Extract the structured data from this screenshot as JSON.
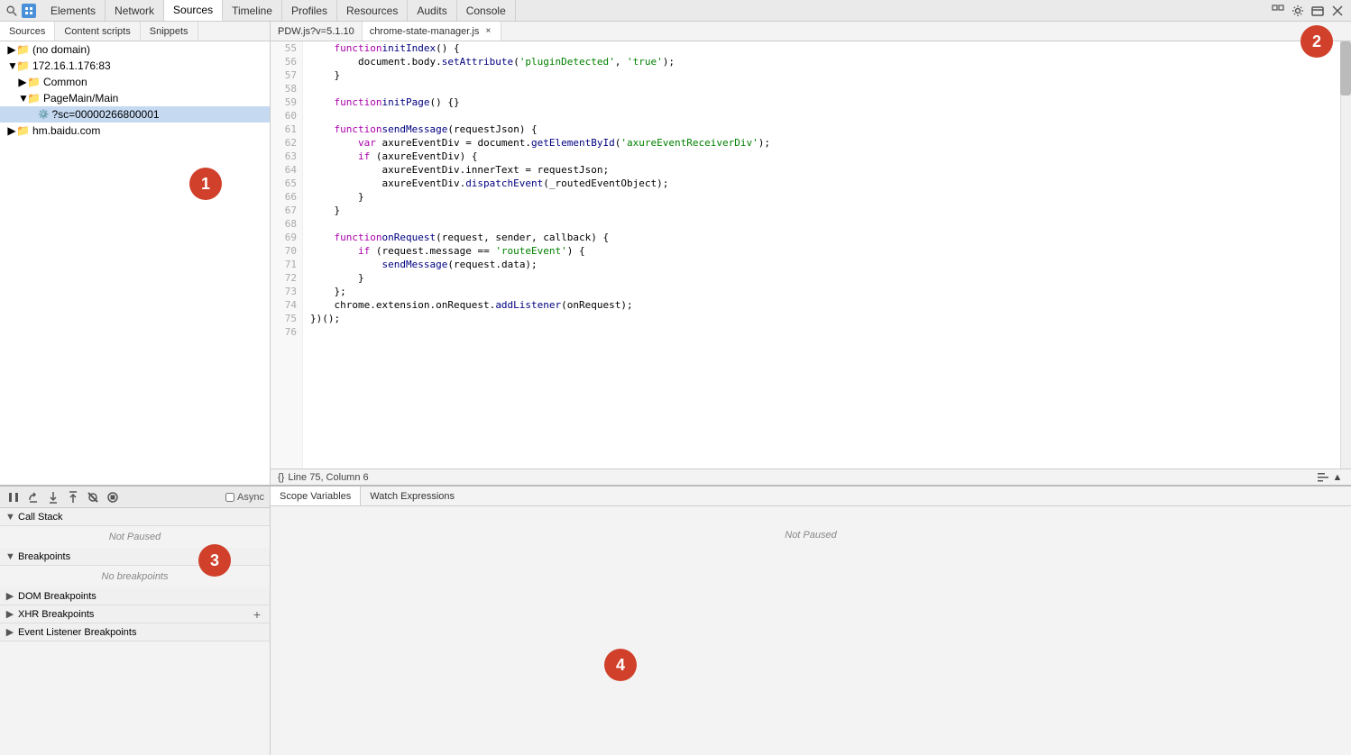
{
  "toolbar": {
    "nav_tabs": [
      {
        "label": "Elements",
        "active": false
      },
      {
        "label": "Network",
        "active": false
      },
      {
        "label": "Sources",
        "active": true
      },
      {
        "label": "Timeline",
        "active": false
      },
      {
        "label": "Profiles",
        "active": false
      },
      {
        "label": "Resources",
        "active": false
      },
      {
        "label": "Audits",
        "active": false
      },
      {
        "label": "Console",
        "active": false
      }
    ]
  },
  "sources_panel": {
    "subtabs": [
      {
        "label": "Sources",
        "active": true
      },
      {
        "label": "Content scripts",
        "active": false
      },
      {
        "label": "Snippets",
        "active": false
      }
    ],
    "tree": {
      "items": [
        {
          "id": "no-domain",
          "label": "(no domain)",
          "indent": 0,
          "type": "folder",
          "expanded": false
        },
        {
          "id": "ip-host",
          "label": "172.16.1.176:83",
          "indent": 0,
          "type": "folder",
          "expanded": true
        },
        {
          "id": "common",
          "label": "Common",
          "indent": 1,
          "type": "folder",
          "expanded": false
        },
        {
          "id": "pagemain",
          "label": "PageMain/Main",
          "indent": 1,
          "type": "folder",
          "expanded": true
        },
        {
          "id": "sc-file",
          "label": "?sc=00000266800001",
          "indent": 2,
          "type": "file",
          "selected": true
        },
        {
          "id": "baidu",
          "label": "hm.baidu.com",
          "indent": 0,
          "type": "folder",
          "expanded": false
        }
      ]
    }
  },
  "editor": {
    "tabs": [
      {
        "label": "PDW.js?v=5.1.10",
        "active": false,
        "closable": false
      },
      {
        "label": "chrome-state-manager.js",
        "active": true,
        "closable": true
      }
    ],
    "status_bar": {
      "icon": "{}",
      "text": "Line 75, Column 6"
    },
    "lines": [
      {
        "num": 55,
        "code": "    function initIndex() {"
      },
      {
        "num": 56,
        "code": "        document.body.setAttribute('pluginDetected', 'true');"
      },
      {
        "num": 57,
        "code": "    }"
      },
      {
        "num": 58,
        "code": ""
      },
      {
        "num": 59,
        "code": "    function initPage() {}"
      },
      {
        "num": 60,
        "code": ""
      },
      {
        "num": 61,
        "code": "    function sendMessage(requestJson) {"
      },
      {
        "num": 62,
        "code": "        var axureEventDiv = document.getElementById('axureEventReceiverDiv');"
      },
      {
        "num": 63,
        "code": "        if (axureEventDiv) {"
      },
      {
        "num": 64,
        "code": "            axureEventDiv.innerText = requestJson;"
      },
      {
        "num": 65,
        "code": "            axureEventDiv.dispatchEvent(_routedEventObject);"
      },
      {
        "num": 66,
        "code": "        }"
      },
      {
        "num": 67,
        "code": "    }"
      },
      {
        "num": 68,
        "code": ""
      },
      {
        "num": 69,
        "code": "    function onRequest(request, sender, callback) {"
      },
      {
        "num": 70,
        "code": "        if (request.message == 'routeEvent') {"
      },
      {
        "num": 71,
        "code": "            sendMessage(request.data);"
      },
      {
        "num": 72,
        "code": "        }"
      },
      {
        "num": 73,
        "code": "    };"
      },
      {
        "num": 74,
        "code": "    chrome.extension.onRequest.addListener(onRequest);"
      },
      {
        "num": 75,
        "code": "})();"
      },
      {
        "num": 76,
        "code": ""
      }
    ]
  },
  "debugger": {
    "toolbar_buttons": [
      "pause",
      "step-over",
      "step-into",
      "step-out",
      "deactivate",
      "stop"
    ],
    "async_label": "Async",
    "call_stack": {
      "label": "Call Stack",
      "status": "Not Paused"
    },
    "breakpoints": {
      "label": "Breakpoints",
      "status": "No breakpoints"
    },
    "dom_breakpoints": {
      "label": "DOM Breakpoints"
    },
    "xhr_breakpoints": {
      "label": "XHR Breakpoints"
    },
    "event_listener_breakpoints": {
      "label": "Event Listener Breakpoints"
    }
  },
  "scope_panel": {
    "tabs": [
      {
        "label": "Scope Variables",
        "active": true
      },
      {
        "label": "Watch Expressions",
        "active": false
      }
    ],
    "status": "Not Paused"
  },
  "annotations": [
    {
      "id": "1",
      "label": "1"
    },
    {
      "id": "2",
      "label": "2"
    },
    {
      "id": "3",
      "label": "3"
    },
    {
      "id": "4",
      "label": "4"
    }
  ]
}
